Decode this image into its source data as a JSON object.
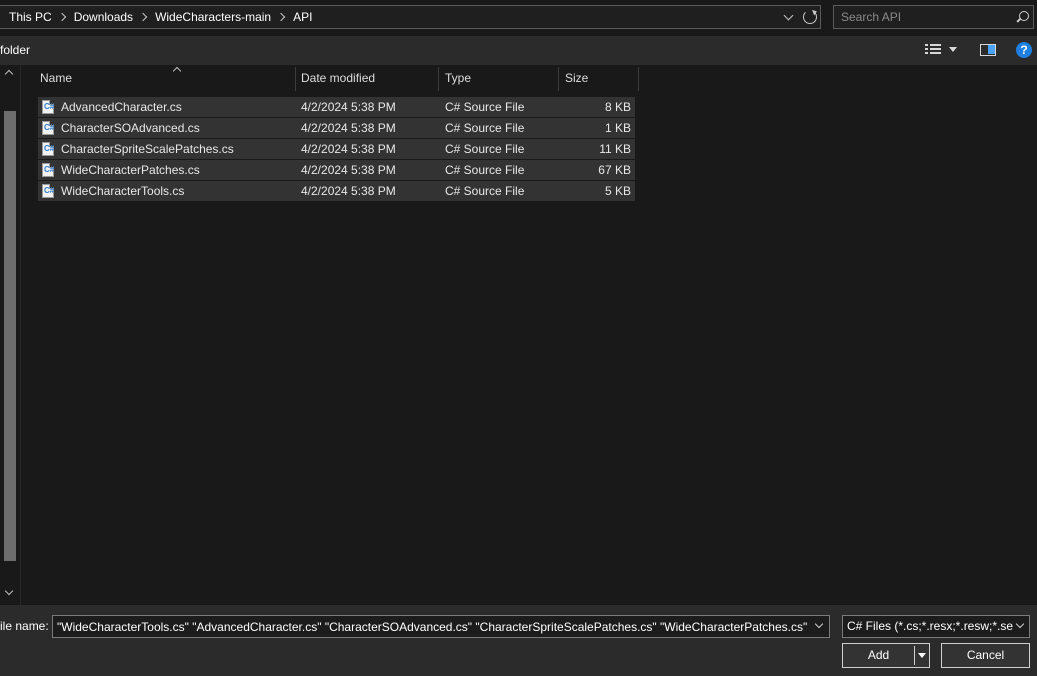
{
  "address": {
    "crumbs": [
      "This PC",
      "Downloads",
      "WideCharacters-main",
      "API"
    ]
  },
  "search": {
    "placeholder": "Search API"
  },
  "toolbar": {
    "new_folder_label": "folder"
  },
  "filelist": {
    "columns": [
      "Name",
      "Date modified",
      "Type",
      "Size"
    ],
    "files": [
      {
        "name": "AdvancedCharacter.cs",
        "date": "4/2/2024 5:38 PM",
        "type": "C# Source File",
        "size": "8 KB"
      },
      {
        "name": "CharacterSOAdvanced.cs",
        "date": "4/2/2024 5:38 PM",
        "type": "C# Source File",
        "size": "1 KB"
      },
      {
        "name": "CharacterSpriteScalePatches.cs",
        "date": "4/2/2024 5:38 PM",
        "type": "C# Source File",
        "size": "11 KB"
      },
      {
        "name": "WideCharacterPatches.cs",
        "date": "4/2/2024 5:38 PM",
        "type": "C# Source File",
        "size": "67 KB"
      },
      {
        "name": "WideCharacterTools.cs",
        "date": "4/2/2024 5:38 PM",
        "type": "C# Source File",
        "size": "5 KB"
      }
    ],
    "file_icon_glyph": "C#"
  },
  "bottom": {
    "file_name_label": "ile name:",
    "file_name_value": "\"WideCharacterTools.cs\" \"AdvancedCharacter.cs\" \"CharacterSOAdvanced.cs\" \"CharacterSpriteScalePatches.cs\" \"WideCharacterPatches.cs\"",
    "filter_value": "C# Files (*.cs;*.resx;*.resw;*.sett",
    "add_label": "Add",
    "cancel_label": "Cancel"
  },
  "colors": {
    "background": "#191919",
    "toolbar": "#2b2b2b",
    "row_selected": "#333333",
    "accent": "#1f7fe0"
  }
}
